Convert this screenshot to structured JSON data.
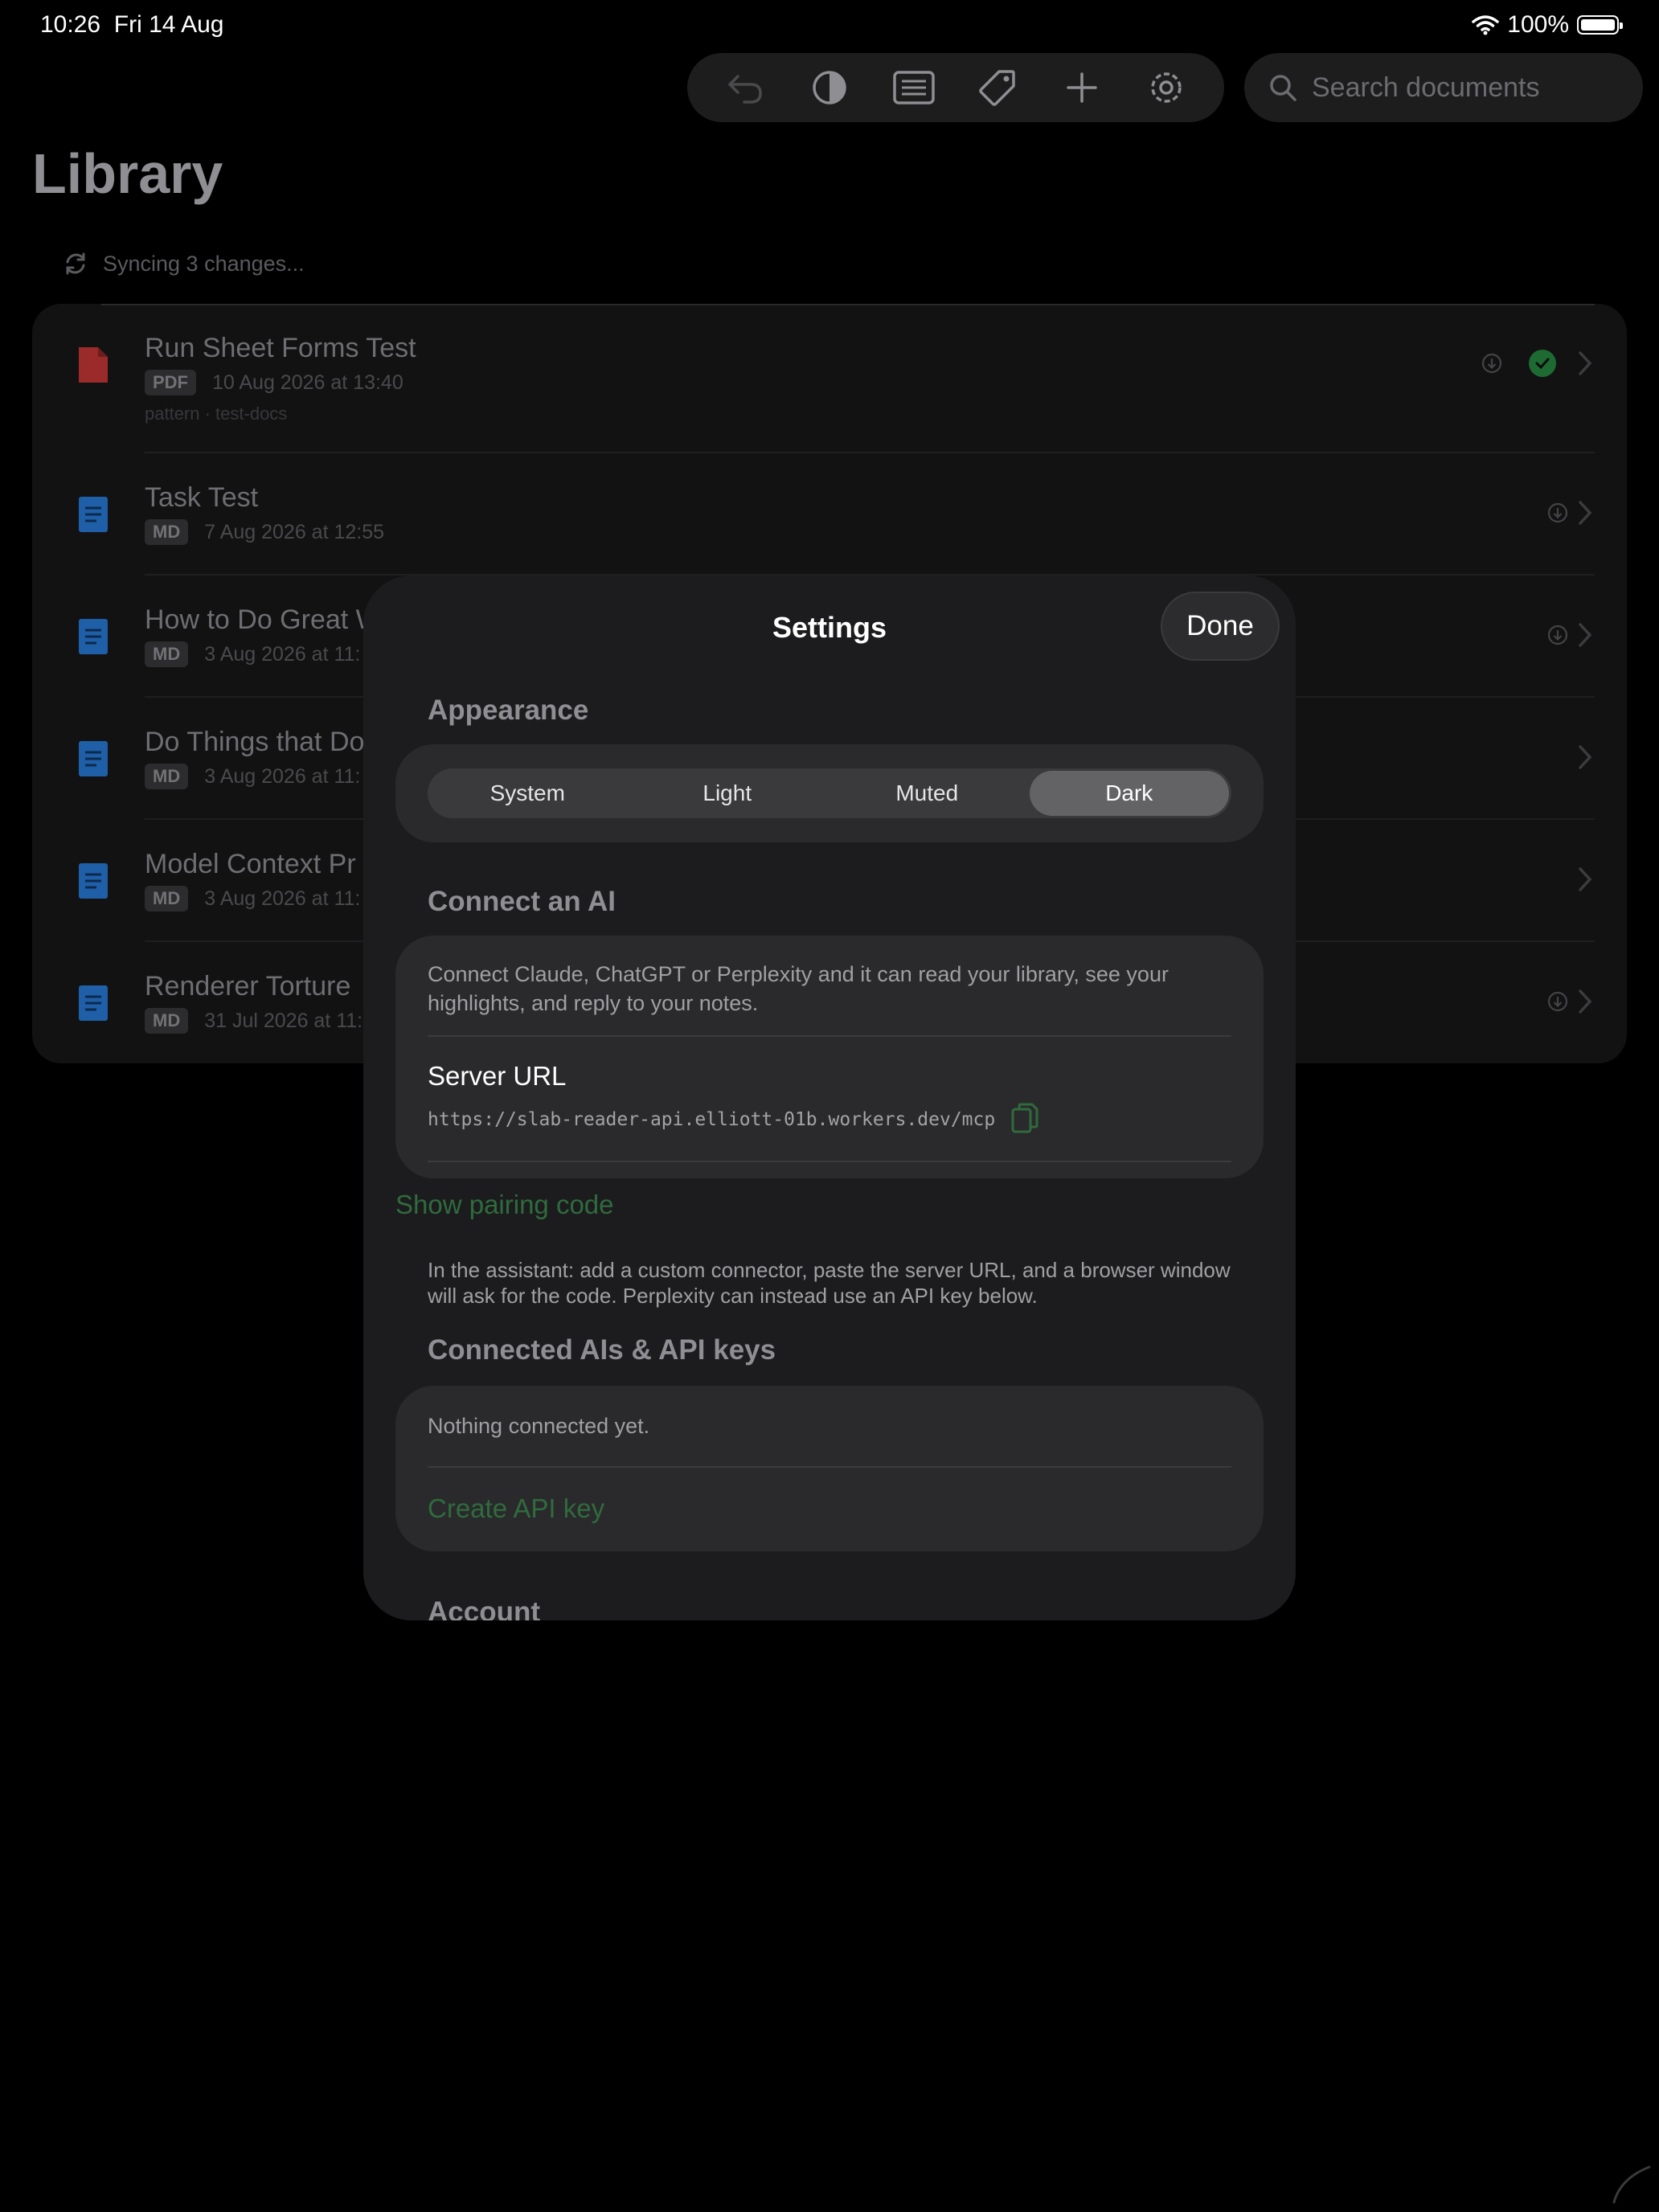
{
  "status_bar": {
    "time": "10:26",
    "date": "Fri 14 Aug",
    "battery": "100%"
  },
  "toolbar": {
    "icons": [
      "undo-icon",
      "contrast-icon",
      "list-icon",
      "tag-icon",
      "plus-icon",
      "gear-icon"
    ],
    "search_placeholder": "Search documents"
  },
  "library": {
    "title": "Library",
    "sync_text": "Syncing 3 changes...",
    "documents": [
      {
        "title": "Run Sheet Forms Test",
        "type": "PDF",
        "date": "10 Aug 2026 at 13:40",
        "tags": "pattern · test-docs",
        "downloaded": true
      },
      {
        "title": "Task Test",
        "type": "MD",
        "date": "7 Aug 2026 at 12:55"
      },
      {
        "title": "How to Do Great W",
        "type": "MD",
        "date": "3 Aug 2026 at 11:"
      },
      {
        "title": "Do Things that Do",
        "type": "MD",
        "date": "3 Aug 2026 at 11:"
      },
      {
        "title": "Model Context Pr",
        "type": "MD",
        "date": "3 Aug 2026 at 11:"
      },
      {
        "title": "Renderer Torture",
        "type": "MD",
        "date": "31 Jul 2026 at 11:"
      }
    ]
  },
  "settings": {
    "title": "Settings",
    "done_label": "Done",
    "appearance": {
      "heading": "Appearance",
      "options": [
        "System",
        "Light",
        "Muted",
        "Dark"
      ],
      "selected": "Dark"
    },
    "connect_ai": {
      "heading": "Connect an AI",
      "description": "Connect Claude, ChatGPT or Perplexity and it can read your library, see your highlights, and reply to your notes.",
      "server_url_label": "Server URL",
      "server_url": "https://slab-reader-api.elliott-01b.workers.dev/mcp",
      "pairing_link": "Show pairing code",
      "footnote": "In the assistant: add a custom connector, paste the server URL, and a browser window will ask for the code. Perplexity can instead use an API key below."
    },
    "connected": {
      "heading": "Connected AIs & API keys",
      "empty_text": "Nothing connected yet.",
      "create_link": "Create API key"
    },
    "account": {
      "heading": "Account"
    }
  },
  "colors": {
    "accent_green": "#2f6b3d",
    "pdf_red": "#9b2a2a",
    "md_blue": "#1f5fa8",
    "modal_bg": "#1c1c1e"
  }
}
